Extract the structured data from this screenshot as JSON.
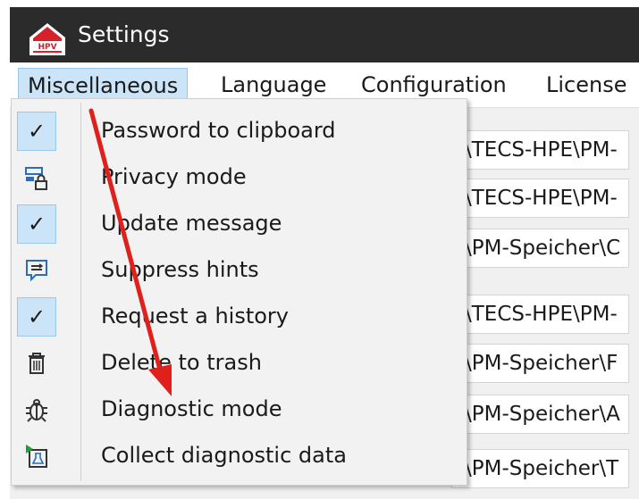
{
  "window": {
    "title": "Settings",
    "logo_text": "HPV"
  },
  "menubar": {
    "items": [
      {
        "label": "Miscellaneous"
      },
      {
        "label": "Language"
      },
      {
        "label": "Configuration"
      },
      {
        "label": "License"
      }
    ]
  },
  "background_rows": [
    "\\TECS-HPE\\PM-",
    "\\TECS-HPE\\PM-",
    "\\PM-Speicher\\C",
    "\\TECS-HPE\\PM-",
    "\\PM-Speicher\\F",
    "\\PM-Speicher\\A",
    "\\PM-Speicher\\T"
  ],
  "dropdown": {
    "items": [
      {
        "label": "Password to clipboard",
        "icon": "checkmark-icon",
        "checked": true
      },
      {
        "label": "Privacy mode",
        "icon": "privacy-lock-icon",
        "checked": false
      },
      {
        "label": "Update message",
        "icon": "checkmark-icon",
        "checked": true
      },
      {
        "label": "Suppress hints",
        "icon": "hint-bubble-icon",
        "checked": false
      },
      {
        "label": "Request a history",
        "icon": "checkmark-icon",
        "checked": true
      },
      {
        "label": "Delete to trash",
        "icon": "trash-icon",
        "checked": false
      },
      {
        "label": "Diagnostic mode",
        "icon": "bug-icon",
        "checked": false
      },
      {
        "label": "Collect diagnostic data",
        "icon": "collect-data-icon",
        "checked": false
      }
    ]
  },
  "colors": {
    "accent": "#cce4f7",
    "accent_border": "#99c8ec",
    "titlebar": "#2b2b2b",
    "arrow": "#e0201a"
  },
  "checkmark_glyph": "✓"
}
